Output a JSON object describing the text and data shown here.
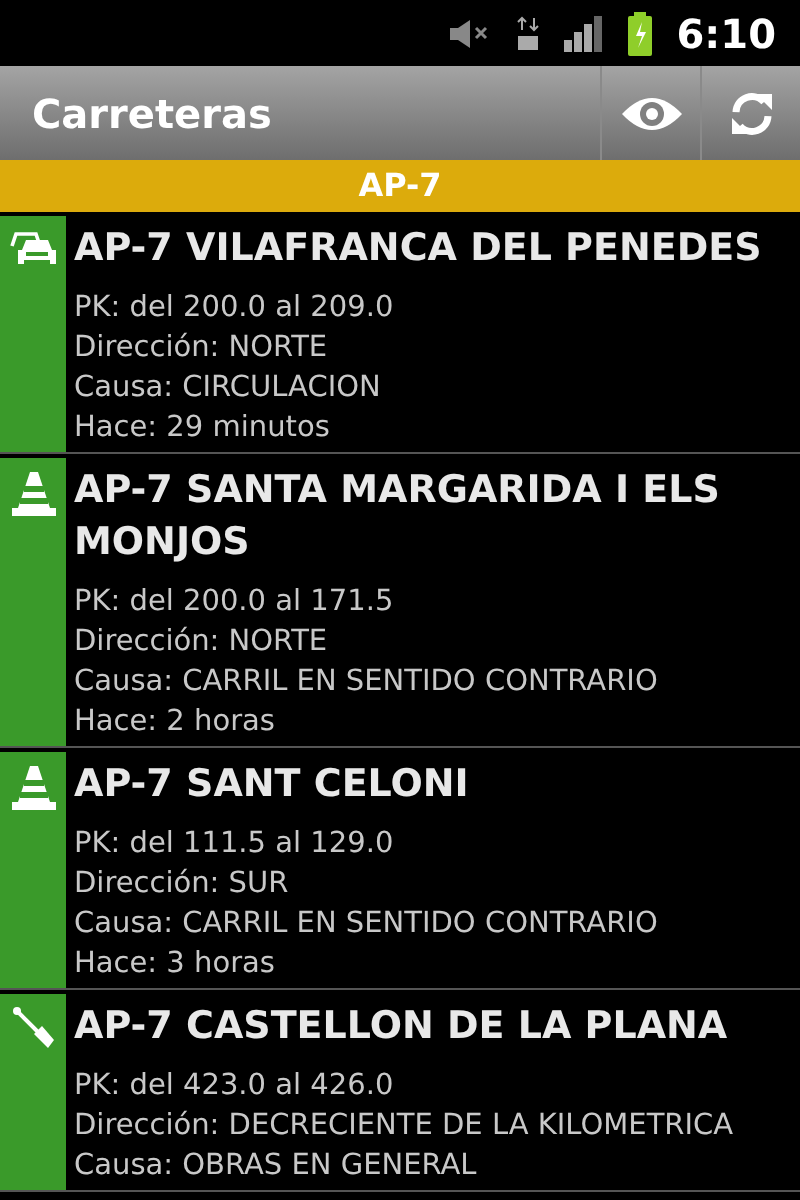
{
  "status_bar": {
    "time": "6:10"
  },
  "action_bar": {
    "title": "Carreteras"
  },
  "section": {
    "title": "AP-7"
  },
  "incidents": [
    {
      "kind": "traffic",
      "title": "AP-7 VILAFRANCA DEL PENEDES",
      "lines": [
        "PK: del 200.0 al 209.0",
        "Dirección: NORTE",
        "Causa: CIRCULACION",
        "Hace: 29 minutos"
      ]
    },
    {
      "kind": "cone",
      "title": "AP-7 SANTA MARGARIDA I ELS MONJOS",
      "lines": [
        "PK: del 200.0 al 171.5",
        "Dirección: NORTE",
        "Causa: CARRIL EN SENTIDO CONTRARIO",
        "Hace: 2 horas"
      ]
    },
    {
      "kind": "cone",
      "title": "AP-7 SANT CELONI",
      "lines": [
        "PK: del 111.5 al 129.0",
        "Dirección: SUR",
        "Causa: CARRIL EN SENTIDO CONTRARIO",
        "Hace: 3 horas"
      ]
    },
    {
      "kind": "works",
      "title": "AP-7 CASTELLON DE LA PLANA",
      "lines": [
        "PK: del 423.0 al 426.0",
        "Dirección: DECRECIENTE DE LA KILOMETRICA",
        "Causa: OBRAS EN GENERAL"
      ]
    }
  ]
}
